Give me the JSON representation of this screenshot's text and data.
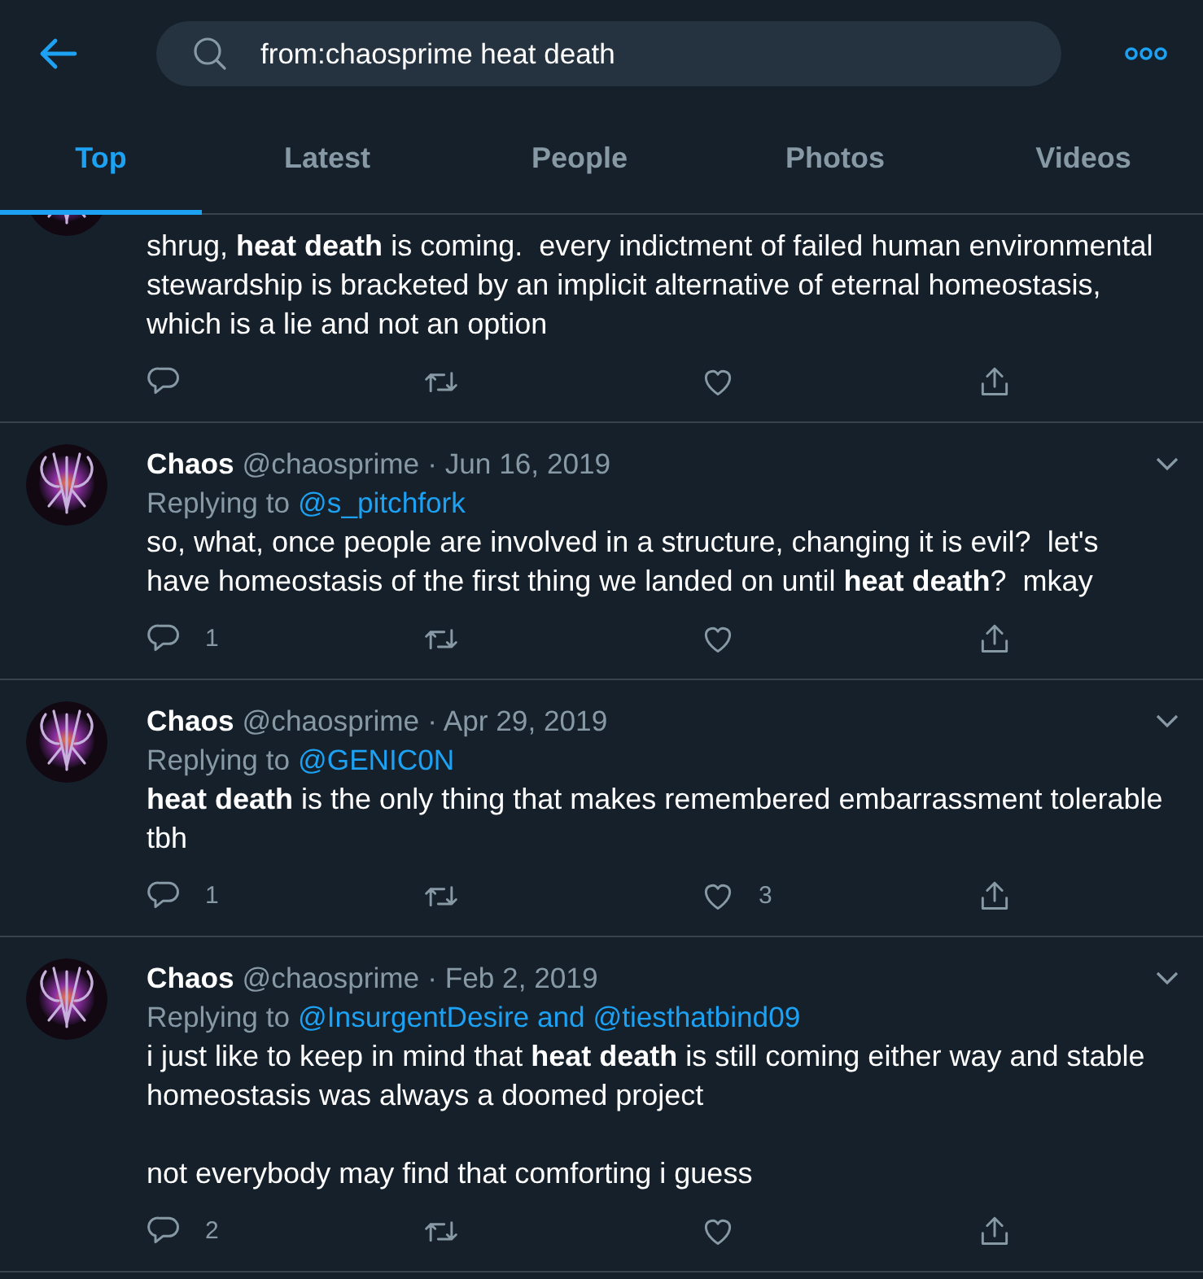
{
  "search": {
    "value": "from:chaosprime heat death"
  },
  "tabs": [
    {
      "label": "Top",
      "selected": true
    },
    {
      "label": "Latest",
      "selected": false
    },
    {
      "label": "People",
      "selected": false
    },
    {
      "label": "Photos",
      "selected": false
    },
    {
      "label": "Videos",
      "selected": false
    }
  ],
  "tweets": [
    {
      "kind": "cut",
      "text": "shrug, **heat death** is coming.  every indictment of failed human environmental stewardship is bracketed by an implicit alternative of eternal homeostasis, which is a lie and not an option"
    },
    {
      "kind": "full",
      "name": "Chaos",
      "handle": "@chaosprime",
      "date": "· Jun 16, 2019",
      "replying_label": "Replying to",
      "replying_to": "@s_pitchfork",
      "text": "so, what, once people are involved in a structure, changing it is evil?  let's have homeostasis of the first thing we landed on until **heat death**?  mkay",
      "replies": "1"
    },
    {
      "kind": "full",
      "name": "Chaos",
      "handle": "@chaosprime",
      "date": "· Apr 29, 2019",
      "replying_label": "Replying to",
      "replying_to": "@GENIC0N",
      "text": "**heat death** is the only thing that makes remembered embarrassment tolerable tbh",
      "replies": "1",
      "likes": "3"
    },
    {
      "kind": "full",
      "name": "Chaos",
      "handle": "@chaosprime",
      "date": "· Feb 2, 2019",
      "replying_label": "Replying to",
      "replying_to": "@InsurgentDesire and @tiesthatbind09",
      "text": "i just like to keep in mind that **heat death** is still coming either way and stable homeostasis was always a doomed project\n\nnot everybody may find that comforting i guess",
      "replies": "2"
    }
  ]
}
